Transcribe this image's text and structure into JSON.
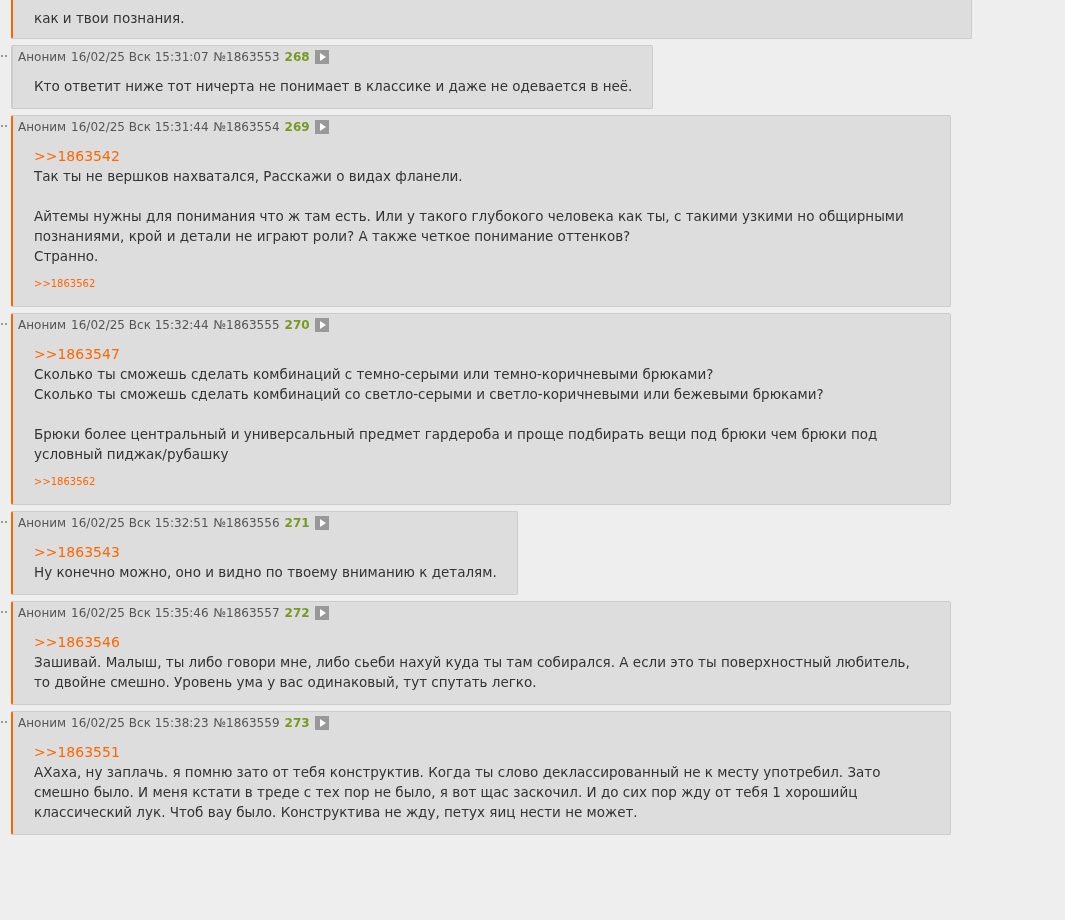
{
  "posts": [
    {
      "kind": "partial",
      "highlighted": true,
      "paragraphs": [
        "как и твои познания."
      ]
    },
    {
      "kind": "full",
      "highlighted": false,
      "name": "Аноним",
      "date": "16/02/25 Вск 15:31:07",
      "number": "№1863553",
      "ordinal": "268",
      "paragraphs": [
        "Кто ответит ниже тот ничерта не понимает в классике и даже не одевается в неё."
      ]
    },
    {
      "kind": "full",
      "highlighted": true,
      "name": "Аноним",
      "date": "16/02/25 Вск 15:31:44",
      "number": "№1863554",
      "ordinal": "269",
      "quote": ">>1863542",
      "paragraphs": [
        "Так ты не вершков нахватался, Расскажи о видах фланели.",
        "Айтемы нужны для понимания что ж там есть. Или у такого глубокого человека как ты, с такими узкими но общирными познаниями, крой и детали не играют роли? А также четкое понимание оттенков?\nСтранно."
      ],
      "replies": [
        ">>1863562"
      ]
    },
    {
      "kind": "full",
      "highlighted": true,
      "name": "Аноним",
      "date": "16/02/25 Вск 15:32:44",
      "number": "№1863555",
      "ordinal": "270",
      "quote": ">>1863547",
      "paragraphs": [
        "Сколько ты сможешь сделать комбинаций с темно-серыми или темно-коричневыми брюками?\nСколько ты сможешь сделать комбинаций со светло-серыми и светло-коричневыми или бежевыми брюками?",
        "Брюки более центральный и универсальный предмет гардероба и проще подбирать вещи под брюки чем брюки под условный пиджак/рубашку"
      ],
      "replies": [
        ">>1863562"
      ]
    },
    {
      "kind": "full",
      "highlighted": true,
      "name": "Аноним",
      "date": "16/02/25 Вск 15:32:51",
      "number": "№1863556",
      "ordinal": "271",
      "quote": ">>1863543",
      "paragraphs": [
        "Ну конечно можно, оно и видно по твоему вниманию к деталям."
      ]
    },
    {
      "kind": "full",
      "highlighted": true,
      "name": "Аноним",
      "date": "16/02/25 Вск 15:35:46",
      "number": "№1863557",
      "ordinal": "272",
      "quote": ">>1863546",
      "paragraphs": [
        "Зашивай. Малыш, ты либо говори мне, либо сьеби нахуй куда ты там собирался. А если это ты поверхностный любитель, то двойне смешно. Уровень ума у вас одинаковый, тут спутать легко."
      ]
    },
    {
      "kind": "full",
      "highlighted": true,
      "name": "Аноним",
      "date": "16/02/25 Вск 15:38:23",
      "number": "№1863559",
      "ordinal": "273",
      "quote": ">>1863551",
      "paragraphs": [
        "АХаха, ну заплачь. я помню зато от тебя конструктив. Когда ты слово деклассированный не к месту употребил. Зато смешно было. И меня кстати в треде с тех пор не было, я вот щас заскочил. И до сих пор жду от тебя 1 хорошийц классический лук. Чтоб вау было. Конструктива не жду, петух яиц нести не может."
      ]
    }
  ]
}
